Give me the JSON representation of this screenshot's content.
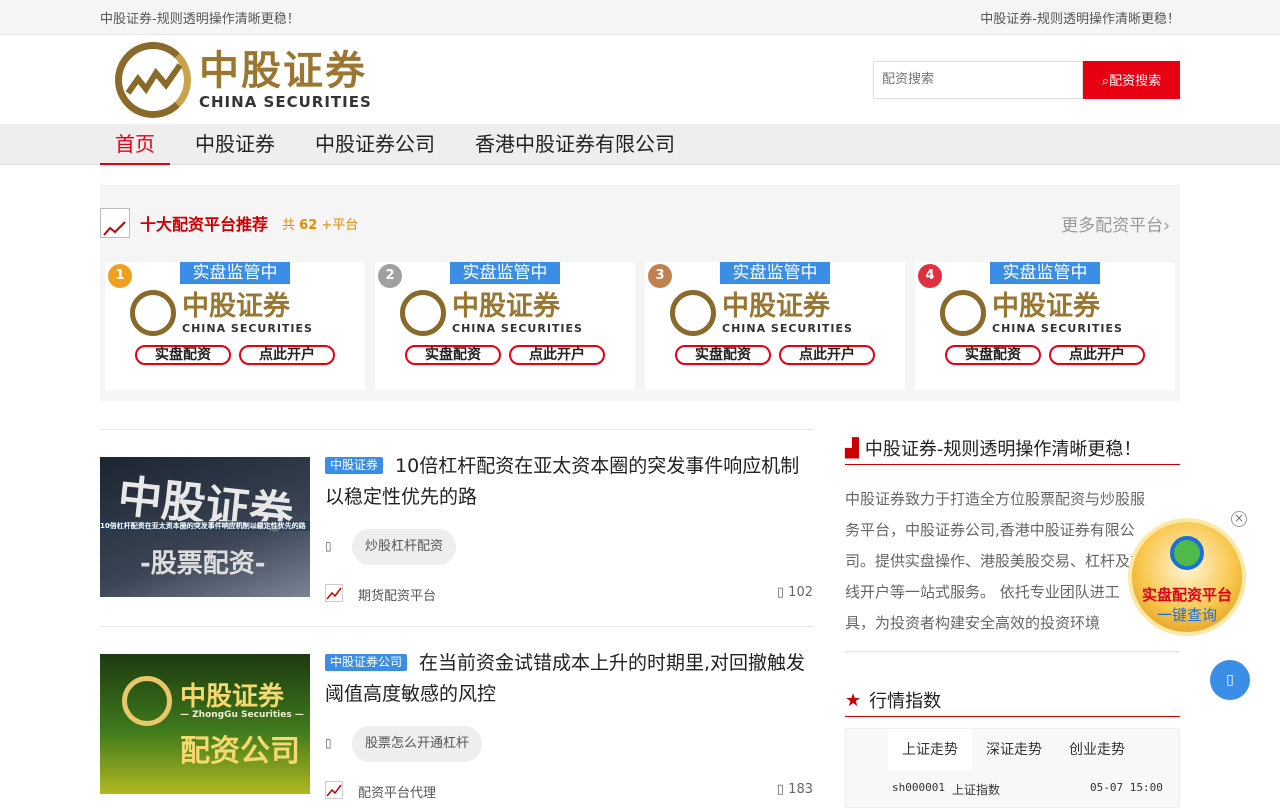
{
  "topbar": {
    "left": "中股证券-规则透明操作清晰更稳！",
    "right": "中股证券-规则透明操作清晰更稳！"
  },
  "logo": {
    "cn": "中股证券",
    "en": "CHINA SECURITIES"
  },
  "search": {
    "placeholder": "配资搜索",
    "button_label": "配资搜索",
    "button_icon": "search-icon"
  },
  "nav": [
    "首页",
    "中股证券",
    "中股证券公司",
    "香港中股证券有限公司"
  ],
  "recommend": {
    "title": "十大配资平台推荐",
    "count_prefix": "共",
    "count": "62",
    "count_suffix": "+平台",
    "more": "更多配资平台",
    "cards": [
      {
        "rank": "1",
        "tag": "实盘监管中",
        "cn": "中股证券",
        "en": "CHINA SECURITIES",
        "btn1": "实盘配资",
        "btn2": "点此开户",
        "medal_color": "#f0a020"
      },
      {
        "rank": "2",
        "tag": "实盘监管中",
        "cn": "中股证券",
        "en": "CHINA SECURITIES",
        "btn1": "实盘配资",
        "btn2": "点此开户",
        "medal_color": "#a0a0a0"
      },
      {
        "rank": "3",
        "tag": "实盘监管中",
        "cn": "中股证券",
        "en": "CHINA SECURITIES",
        "btn1": "实盘配资",
        "btn2": "点此开户",
        "medal_color": "#c08050"
      },
      {
        "rank": "4",
        "tag": "实盘监管中",
        "cn": "中股证券",
        "en": "CHINA SECURITIES",
        "btn1": "实盘配资",
        "btn2": "点此开户",
        "medal_color": "#e03040"
      }
    ]
  },
  "posts": [
    {
      "category": "中股证券",
      "title": "10倍杠杆配资在亚太资本圈的突发事件响应机制以稳定性优先的路",
      "tag": "炒股杠杆配资",
      "author": "期货配资平台",
      "views": "102",
      "thumb_big": "中股证券",
      "thumb_strip": "10倍杠杆配资在亚太资本圈的突发事件响应机制以稳定性优先的路",
      "thumb_sub": "-股票配资-"
    },
    {
      "category": "中股证券公司",
      "title": "在当前资金试错成本上升的时期里,对回撤触发阈值高度敏感的风控",
      "tag": "股票怎么开通杠杆",
      "author": "配资平台代理",
      "views": "183",
      "thumb_big": "中股证券",
      "thumb_strip": "— ZhongGu Securities —",
      "thumb_sub": "配资公司"
    }
  ],
  "sidebar": {
    "title": "中股证券-规则透明操作清晰更稳！",
    "desc": "中股证券致力于打造全方位股票配资与炒股服务平台，中股证券公司,香港中股证券有限公司。提供实盘操作、港股美股交易、杠杆及在线开户等一站式服务。 依托专业团队进工具，为投资者构建安全高效的投资环境",
    "market_title": "行情指数",
    "market_tabs": [
      "上证走势",
      "深证走势",
      "创业走势"
    ],
    "market_row": {
      "code": "sh000001",
      "name": "上证指数",
      "time": "05-07 15:00"
    }
  },
  "badge": {
    "line1": "实盘配资平台",
    "line2": "一键查询"
  },
  "colors": {
    "accent": "#e60012",
    "blue": "#3a8ee6",
    "gold": "#9a7630"
  }
}
